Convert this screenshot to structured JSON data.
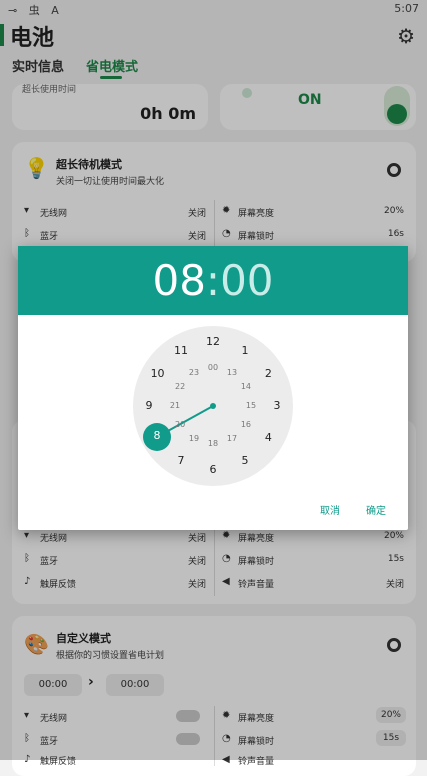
{
  "status_bar": {
    "left_icons": "⊸ 虫 A",
    "time": "5:07"
  },
  "header": {
    "title": "电池",
    "tabs": [
      "实时信息",
      "省电模式"
    ]
  },
  "top_card": {
    "partial_label": "超长使用时间",
    "duration": "0h 0m",
    "toggle_label": "ON"
  },
  "standby_card": {
    "title": "超长待机模式",
    "subtitle": "关闭一切让使用时间最大化",
    "rows": [
      {
        "label": "无线网",
        "value": "关闭"
      },
      {
        "label": "屏幕亮度",
        "value": "20%"
      },
      {
        "label": "蓝牙",
        "value": "关闭"
      },
      {
        "label": "屏幕锁时",
        "value": "16s"
      }
    ]
  },
  "middle_card": {
    "rows": [
      {
        "label": "无线网",
        "value": "关闭"
      },
      {
        "label": "屏幕亮度",
        "value": "20%"
      },
      {
        "label": "蓝牙",
        "value": "关闭"
      },
      {
        "label": "屏幕锁时",
        "value": "15s"
      },
      {
        "label": "触屏反馈",
        "value": "关闭"
      },
      {
        "label": "铃声音量",
        "value": "关闭"
      }
    ]
  },
  "custom_card": {
    "title": "自定义模式",
    "subtitle": "根据你的习惯设置省电计划",
    "start_time": "00:00",
    "end_time": "00:00",
    "rows": [
      {
        "label": "无线网",
        "value": ""
      },
      {
        "label": "屏幕亮度",
        "value": "20%"
      },
      {
        "label": "蓝牙",
        "value": ""
      },
      {
        "label": "屏幕锁时",
        "value": "15s"
      },
      {
        "label": "触屏反馈",
        "value": ""
      },
      {
        "label": "铃声音量",
        "value": ""
      }
    ]
  },
  "time_picker": {
    "hour": "08",
    "separator": ":",
    "minute": "00",
    "outer_numbers": [
      "12",
      "1",
      "2",
      "3",
      "4",
      "5",
      "6",
      "7",
      "8",
      "9",
      "10",
      "11"
    ],
    "inner_numbers": [
      "00",
      "13",
      "14",
      "15",
      "16",
      "17",
      "18",
      "19",
      "20",
      "21",
      "22",
      "23"
    ],
    "selected_hour": "8",
    "cancel_label": "取消",
    "ok_label": "确定"
  },
  "colors": {
    "accent": "#1e8a4a",
    "dialog_teal": "#109b8b"
  }
}
